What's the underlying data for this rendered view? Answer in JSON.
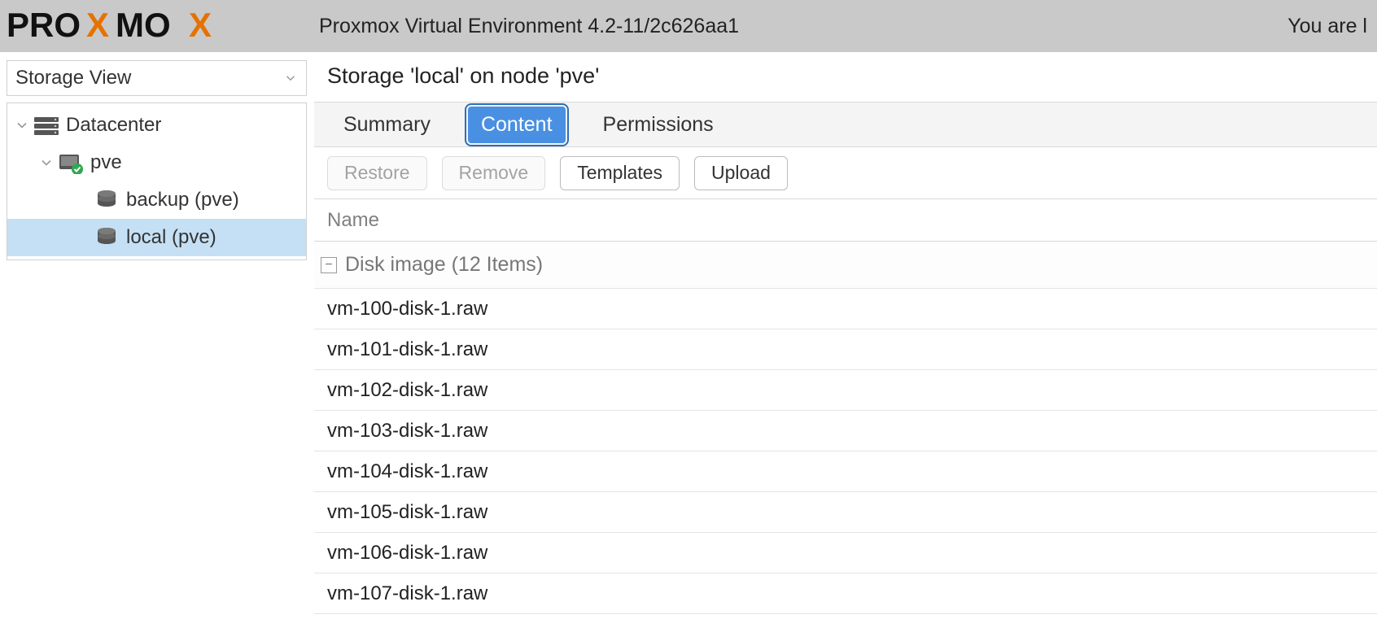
{
  "header": {
    "title": "Proxmox Virtual Environment 4.2-11/2c626aa1",
    "login_text": "You are l"
  },
  "sidebar": {
    "view_label": "Storage View",
    "tree": {
      "root_label": "Datacenter",
      "node_label": "pve",
      "storages": [
        {
          "label": "backup (pve)",
          "selected": false
        },
        {
          "label": "local (pve)",
          "selected": true
        }
      ]
    }
  },
  "panel": {
    "title": "Storage 'local' on node 'pve'",
    "tabs": {
      "summary": "Summary",
      "content": "Content",
      "permissions": "Permissions"
    },
    "toolbar": {
      "restore": "Restore",
      "remove": "Remove",
      "templates": "Templates",
      "upload": "Upload"
    },
    "grid": {
      "col_name": "Name",
      "group_label": "Disk image (12 Items)",
      "rows": [
        "vm-100-disk-1.raw",
        "vm-101-disk-1.raw",
        "vm-102-disk-1.raw",
        "vm-103-disk-1.raw",
        "vm-104-disk-1.raw",
        "vm-105-disk-1.raw",
        "vm-106-disk-1.raw",
        "vm-107-disk-1.raw"
      ]
    }
  }
}
